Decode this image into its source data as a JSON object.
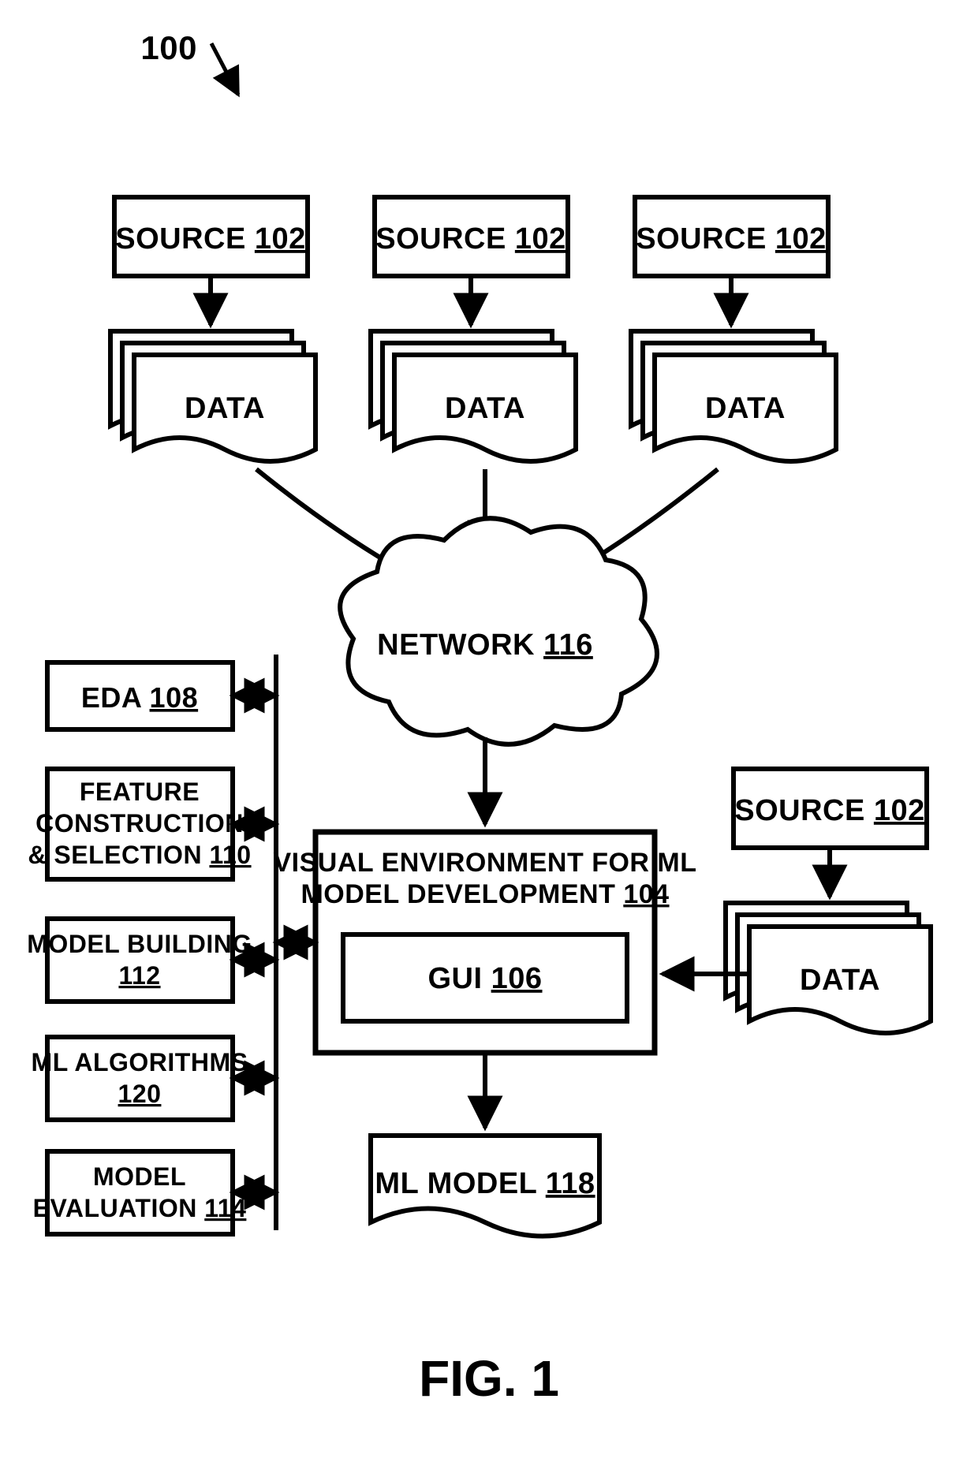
{
  "figure_ref": "100",
  "caption": "FIG. 1",
  "sources": {
    "label_prefix": "SOURCE",
    "label_num": "102",
    "data_label": "DATA"
  },
  "network": {
    "label_prefix": "NETWORK",
    "label_num": "116"
  },
  "visual_env": {
    "line1": "VISUAL ENVIRONMENT FOR ML",
    "line2_prefix": "MODEL DEVELOPMENT",
    "line2_num": "104",
    "gui_prefix": "GUI",
    "gui_num": "106"
  },
  "ml_model": {
    "label_prefix": "ML MODEL",
    "label_num": "118"
  },
  "side": {
    "eda_prefix": "EDA",
    "eda_num": "108",
    "feat_line1": "FEATURE",
    "feat_line2": "CONSTRUCTION",
    "feat_line3_prefix": "& SELECTION",
    "feat_line3_num": "110",
    "mb_line1": "MODEL BUILDING",
    "mb_num": "112",
    "alg_line1": "ML ALGORITHMS",
    "alg_num": "120",
    "me_line1": "MODEL",
    "me_line2_prefix": "EVALUATION",
    "me_line2_num": "114"
  }
}
